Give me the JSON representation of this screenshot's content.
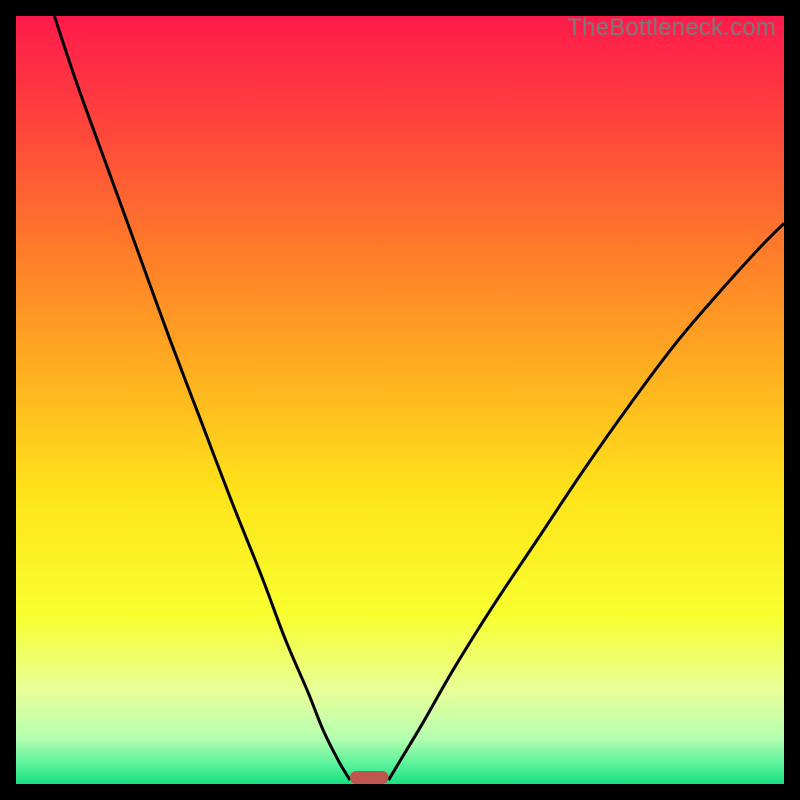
{
  "watermark": "TheBottleneck.com",
  "chart_data": {
    "type": "line",
    "title": "",
    "xlabel": "",
    "ylabel": "",
    "xlim": [
      0,
      100
    ],
    "ylim": [
      0,
      100
    ],
    "background_gradient_stops": [
      {
        "offset": 0.0,
        "color": "#ff1a4b"
      },
      {
        "offset": 0.12,
        "color": "#ff3d3f"
      },
      {
        "offset": 0.3,
        "color": "#ff7a2a"
      },
      {
        "offset": 0.48,
        "color": "#ffb41f"
      },
      {
        "offset": 0.62,
        "color": "#ffe31a"
      },
      {
        "offset": 0.78,
        "color": "#f8ff2e"
      },
      {
        "offset": 0.88,
        "color": "#e7ff9a"
      },
      {
        "offset": 0.94,
        "color": "#b6ffb0"
      },
      {
        "offset": 0.975,
        "color": "#57f29b"
      },
      {
        "offset": 1.0,
        "color": "#18e07f"
      }
    ],
    "series": [
      {
        "name": "bottleneck-curve-left",
        "x": [
          5,
          8,
          12,
          16,
          20,
          24,
          28,
          32,
          35,
          38,
          40,
          42,
          43.5
        ],
        "y": [
          100,
          91,
          80,
          69,
          58,
          47.5,
          37,
          27,
          19,
          12,
          7,
          3,
          0.5
        ]
      },
      {
        "name": "bottleneck-curve-right",
        "x": [
          48.5,
          50,
          53,
          57,
          62,
          68,
          74,
          80,
          86,
          92,
          97,
          100
        ],
        "y": [
          0.5,
          3,
          8,
          15,
          23,
          32,
          41,
          49.5,
          57.5,
          64.5,
          70,
          73
        ]
      }
    ],
    "marker": {
      "name": "optimal-marker",
      "x_center": 46,
      "width": 5,
      "color": "#c1554f"
    }
  }
}
